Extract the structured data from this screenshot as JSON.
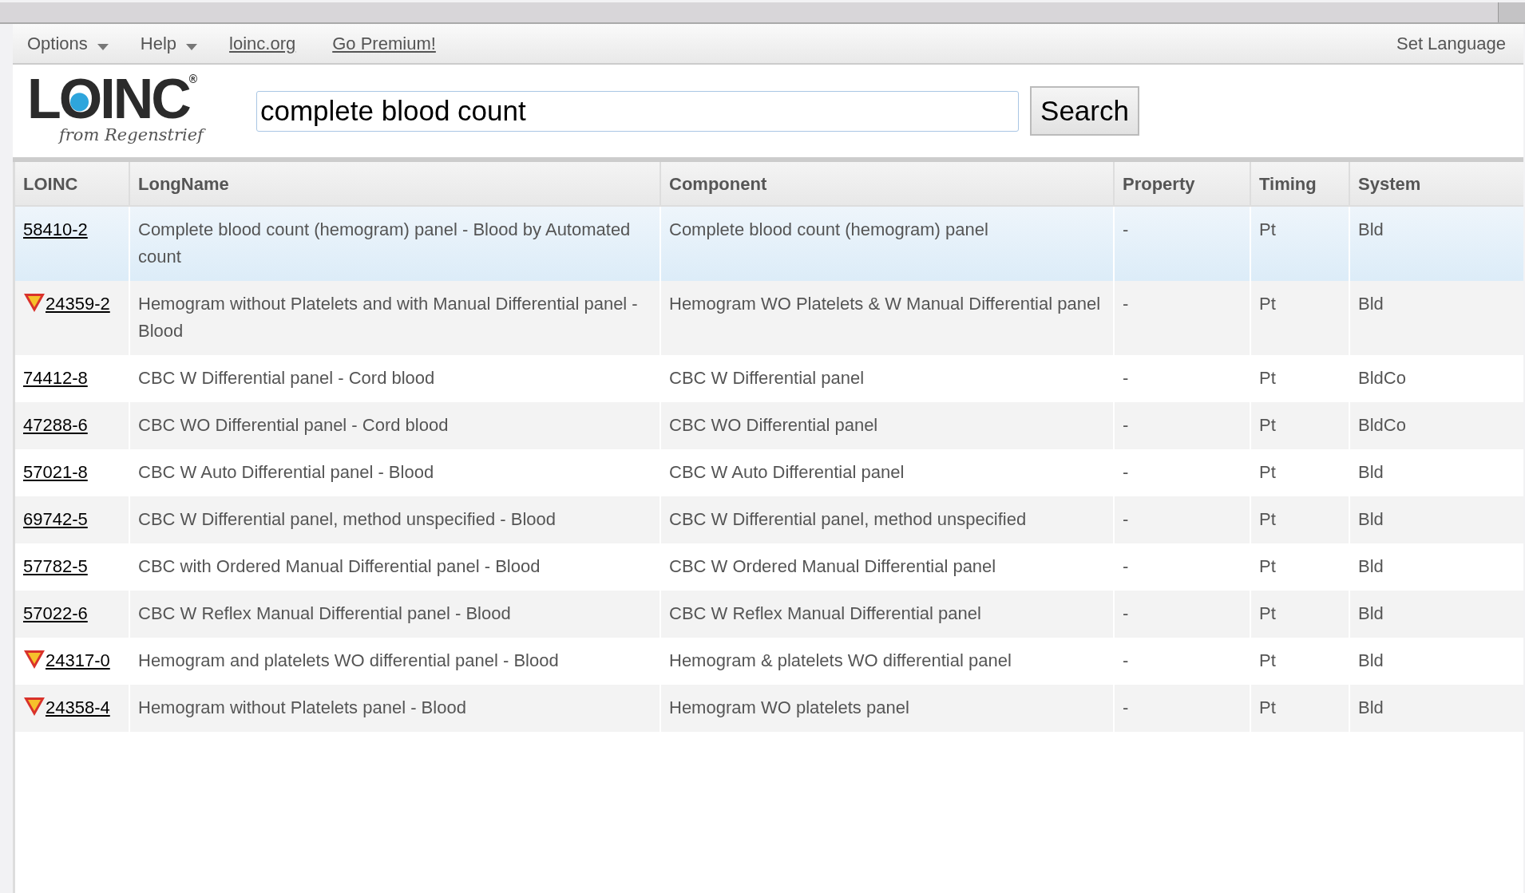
{
  "menu": [
    {
      "label": "Options",
      "kind": "dropdown"
    },
    {
      "label": "Help",
      "kind": "dropdown"
    },
    {
      "label": "loinc.org",
      "kind": "link"
    },
    {
      "label": "Go Premium!",
      "kind": "link"
    }
  ],
  "set_language": "Set Language",
  "logo": {
    "wordmark": "LOINC",
    "registered": "®",
    "tagline": "from Regenstrief"
  },
  "search": {
    "value": "complete blood count",
    "button": "Search"
  },
  "table": {
    "columns": [
      "LOINC",
      "LongName",
      "Component",
      "Property",
      "Timing",
      "System"
    ],
    "rows": [
      {
        "selected": true,
        "warning": false,
        "cells": [
          "58410-2",
          "Complete blood count (hemogram) panel - Blood by Automated count",
          "Complete blood count (hemogram) panel",
          "-",
          "Pt",
          "Bld"
        ]
      },
      {
        "selected": false,
        "warning": true,
        "cells": [
          "24359-2",
          "Hemogram without Platelets and with Manual Differential panel - Blood",
          "Hemogram WO Platelets & W Manual Differential panel",
          "-",
          "Pt",
          "Bld"
        ]
      },
      {
        "selected": false,
        "warning": false,
        "cells": [
          "74412-8",
          "CBC W Differential panel - Cord blood",
          "CBC W Differential panel",
          "-",
          "Pt",
          "BldCo"
        ]
      },
      {
        "selected": false,
        "warning": false,
        "cells": [
          "47288-6",
          "CBC WO Differential panel - Cord blood",
          "CBC WO Differential panel",
          "-",
          "Pt",
          "BldCo"
        ]
      },
      {
        "selected": false,
        "warning": false,
        "cells": [
          "57021-8",
          "CBC W Auto Differential panel - Blood",
          "CBC W Auto Differential panel",
          "-",
          "Pt",
          "Bld"
        ]
      },
      {
        "selected": false,
        "warning": false,
        "cells": [
          "69742-5",
          "CBC W Differential panel, method unspecified - Blood",
          "CBC W Differential panel, method unspecified",
          "-",
          "Pt",
          "Bld"
        ]
      },
      {
        "selected": false,
        "warning": false,
        "cells": [
          "57782-5",
          "CBC with Ordered Manual Differential panel - Blood",
          "CBC W Ordered Manual Differential panel",
          "-",
          "Pt",
          "Bld"
        ]
      },
      {
        "selected": false,
        "warning": false,
        "cells": [
          "57022-6",
          "CBC W Reflex Manual Differential panel - Blood",
          "CBC W Reflex Manual Differential panel",
          "-",
          "Pt",
          "Bld"
        ]
      },
      {
        "selected": false,
        "warning": true,
        "cells": [
          "24317-0",
          "Hemogram and platelets WO differential panel - Blood",
          "Hemogram & platelets WO differential panel",
          "-",
          "Pt",
          "Bld"
        ]
      },
      {
        "selected": false,
        "warning": true,
        "cells": [
          "24358-4",
          "Hemogram without Platelets panel - Blood",
          "Hemogram WO platelets panel",
          "-",
          "Pt",
          "Bld"
        ]
      }
    ]
  }
}
